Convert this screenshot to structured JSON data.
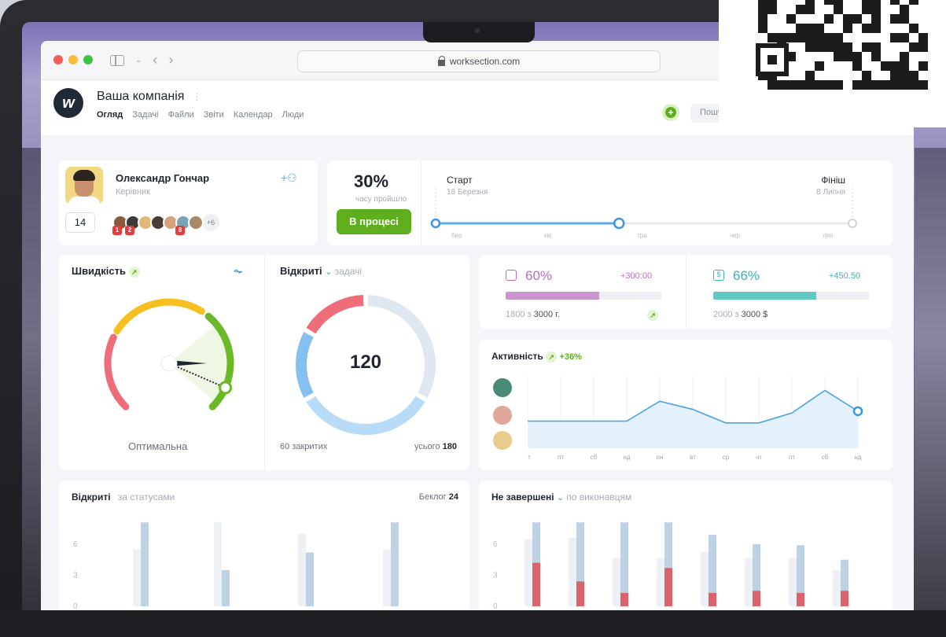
{
  "browser": {
    "url": "worksection.com"
  },
  "header": {
    "company": "Ваша компанія",
    "nav": [
      "Огляд",
      "Задачі",
      "Файли",
      "Звіти",
      "Календар",
      "Люди"
    ],
    "search_placeholder": "Пошу"
  },
  "profile": {
    "name": "Олександр Гончар",
    "role": "Керівник",
    "count": "14",
    "team_avatars": [
      {
        "color": "#8b5a3c",
        "badge": "1"
      },
      {
        "color": "#3e3a38",
        "badge": "2"
      },
      {
        "color": "#e0b97a",
        "badge": ""
      },
      {
        "color": "#4a3b36",
        "badge": ""
      },
      {
        "color": "#d6a17c",
        "badge": ""
      },
      {
        "color": "#7aa3b6",
        "badge": "8"
      },
      {
        "color": "#a88a6a",
        "badge": ""
      }
    ],
    "more": "+6"
  },
  "progress": {
    "percent": "30%",
    "time_label": "часу пройшло",
    "status": "В процесі",
    "start_label": "Старт",
    "start_date": "18 Березня",
    "finish_label": "Фініш",
    "finish_date": "8 Липня",
    "months": [
      "бер",
      "кві",
      "тра",
      "чер",
      "лип"
    ],
    "fraction": 0.44
  },
  "speed": {
    "title": "Швидкість",
    "status": "Оптимальна",
    "gauge_level": 0.92
  },
  "open_tasks": {
    "title": "Відкриті",
    "subtitle": "задачі",
    "total_value": "120",
    "closed_label": "60 закритих",
    "total_label": "усього",
    "total": "180"
  },
  "budget": {
    "time": {
      "percent": "60%",
      "delta": "+300:00",
      "used": "1800 з",
      "limit": "3000 г.",
      "fraction": 0.6,
      "color": "#c996d0"
    },
    "money": {
      "percent": "66%",
      "delta": "+450.50",
      "used": "2000 з",
      "limit": "3000 $",
      "fraction": 0.66,
      "color": "#5fc9c4"
    }
  },
  "activity": {
    "title": "Активність",
    "delta": "+36%",
    "days": [
      "чт",
      "пт",
      "сб",
      "нд",
      "пн",
      "вт",
      "ср",
      "чт",
      "пт",
      "сб",
      "нд"
    ]
  },
  "by_status": {
    "title": "Відкриті",
    "subtitle": "за статусами",
    "backlog_label": "Беклог",
    "backlog": "24",
    "y_ticks": [
      "6",
      "3",
      "0"
    ]
  },
  "by_assignee": {
    "title": "Не завершені",
    "subtitle": "по виконавцям",
    "y_ticks": [
      "6",
      "3",
      "0"
    ]
  },
  "chart_data": [
    {
      "type": "line",
      "title": "Активність",
      "x": [
        "чт",
        "пт",
        "сб",
        "нд",
        "пн",
        "вт",
        "ср",
        "чт",
        "пт",
        "сб",
        "нд"
      ],
      "y": [
        3,
        3,
        3,
        3,
        5.2,
        4.3,
        2.8,
        2.8,
        3.9,
        6.4,
        4.1
      ],
      "ylim": [
        0,
        8
      ]
    },
    {
      "type": "bar",
      "title": "Відкриті за статусами",
      "y_ticks": [
        0,
        3,
        6
      ],
      "ylim": [
        0,
        8.5
      ],
      "series": [
        {
          "values": [
            5.5,
            8.1,
            7.6,
            4.7,
            7.0,
            6.1,
            5.5,
            8.1
          ]
        }
      ],
      "groups": [
        {
          "back": 5.5,
          "front": 8.1
        },
        {
          "back": 8.1,
          "front": 3.5
        },
        {
          "back": 7.0,
          "front": 5.2
        },
        {
          "back": 5.5,
          "front": 8.1
        }
      ]
    },
    {
      "type": "bar",
      "title": "Не завершені по виконавцям",
      "y_ticks": [
        0,
        3,
        6
      ],
      "ylim": [
        0,
        8.5
      ],
      "groups": [
        {
          "back": 6.5,
          "front": 8.1,
          "red": 4.2
        },
        {
          "back": 6.6,
          "front": 8.1,
          "red": 2.4
        },
        {
          "back": 4.7,
          "front": 8.1,
          "red": 1.3
        },
        {
          "back": 4.7,
          "front": 8.1,
          "red": 3.7
        },
        {
          "back": 5.3,
          "front": 6.9,
          "red": 1.3
        },
        {
          "back": 4.7,
          "front": 6.0,
          "red": 1.5
        },
        {
          "back": 4.7,
          "front": 5.9,
          "red": 1.3
        },
        {
          "back": 3.5,
          "front": 4.5,
          "red": 1.5
        }
      ]
    }
  ]
}
